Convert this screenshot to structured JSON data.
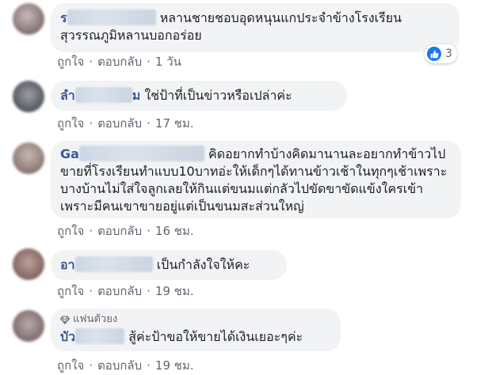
{
  "colors": {
    "name_link": "#385898",
    "bubble_bg": "#f2f3f5",
    "meta_text": "#606770",
    "like_blue": "#1877f2"
  },
  "comments": [
    {
      "author_visible": "ร",
      "author_suffix": "",
      "text": "หลานชายชอบอุดหนุนแกประจำข้างโรงเรียน สุวรรณภูมิหลานบอกอร่อย",
      "like_label": "ถูกใจ",
      "reply_label": "ตอบกลับ",
      "time": "1 วัน",
      "reaction_icon": "like-icon",
      "reaction_count": "3"
    },
    {
      "author_visible": "ลำ",
      "author_suffix": "ม",
      "text": "ใช่ป้าที่เป็นข่าวหรือเปล่าค่ะ",
      "like_label": "ถูกใจ",
      "reply_label": "ตอบกลับ",
      "time": "17 ชม."
    },
    {
      "author_visible": "Ga",
      "author_suffix": "",
      "text": "คิดอยากทำบ้างคิดมานานละอยากทำข้าวไปขายที่โรงเรียนทำแบบ10บาทอ่ะให้เด็กๆได้ทานข้าวเช้าในทุกๆเช้าเพราะบางบ้านไม่ใส่ใจลูกเลยให้กินแต่ขนมแต่กลัวไปขัดขาขัดแข้งใครเข้าเพราะมีคนเขาขายอยู่แต่เป็นขนมสะส่วนใหญ่",
      "like_label": "ถูกใจ",
      "reply_label": "ตอบกลับ",
      "time": "16 ชม."
    },
    {
      "author_visible": "อา",
      "author_suffix": "",
      "text": "เป็นกำลังใจให้คะ",
      "like_label": "ถูกใจ",
      "reply_label": "ตอบกลับ",
      "time": "19 ชม."
    },
    {
      "badge": "แฟนตัวยง",
      "badge_icon": "diamond-icon",
      "author_visible": "บัว",
      "author_suffix": "",
      "text": "สู้ค่ะป้าขอให้ขายได้เงินเยอะๆค่ะ",
      "like_label": "ถูกใจ",
      "reply_label": "ตอบกลับ",
      "time": "19 ชม."
    }
  ]
}
